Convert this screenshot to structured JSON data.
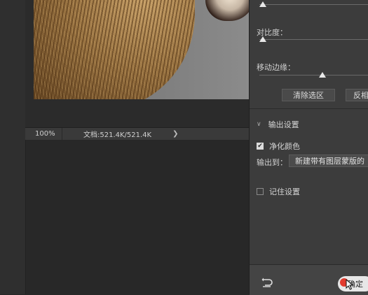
{
  "canvas": {
    "zoom": "100%",
    "document_info": "文档:521.4K/521.4K",
    "arrow": "❯"
  },
  "panel": {
    "contrast_label": "对比度：",
    "shift_edge_label": "移动边缘：",
    "sliders": {
      "top": 0.0,
      "contrast": 0.0,
      "shift_edge": 0.58
    },
    "clear_selection_label": "清除选区",
    "invert_label": "反相",
    "output_settings": {
      "title": "输出设置",
      "decontaminate_label": "净化颜色",
      "decontaminate_checked": true,
      "output_to_label": "输出到：",
      "output_to_value": "新建带有图层蒙版的",
      "remember_label": "记住设置",
      "remember_checked": false
    },
    "ok_label": "确定"
  },
  "colors": {
    "panel_bg": "#3c3c3c",
    "canvas_bg": "#282828",
    "accent_red": "#e23b2e"
  }
}
